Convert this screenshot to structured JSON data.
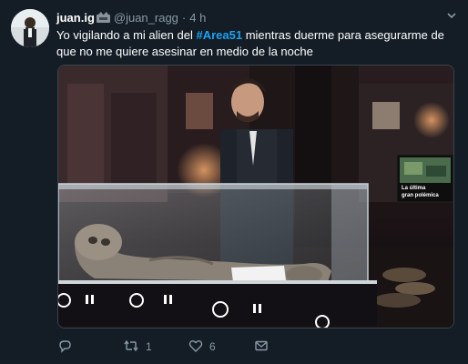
{
  "tweet": {
    "display_name": "juan.ig",
    "handle": "@juan_ragg",
    "separator": "·",
    "time": "4 h",
    "text_before": "Yo vigilando a mi alien del ",
    "hashtag": "#Area51",
    "text_after": " mientras duerme para asegurarme de que no me quiere asesinar en medio de la noche"
  },
  "media": {
    "tv_caption_line1": "La última",
    "tv_caption_line2": "gran polémica"
  },
  "actions": {
    "reply_icon": "reply-icon",
    "retweet_icon": "retweet-icon",
    "like_icon": "heart-icon",
    "dm_icon": "envelope-icon",
    "retweet_count": "1",
    "like_count": "6"
  },
  "colors": {
    "background": "#141d26",
    "text": "#ffffff",
    "secondary": "#8899a6",
    "link": "#1da1f2"
  }
}
